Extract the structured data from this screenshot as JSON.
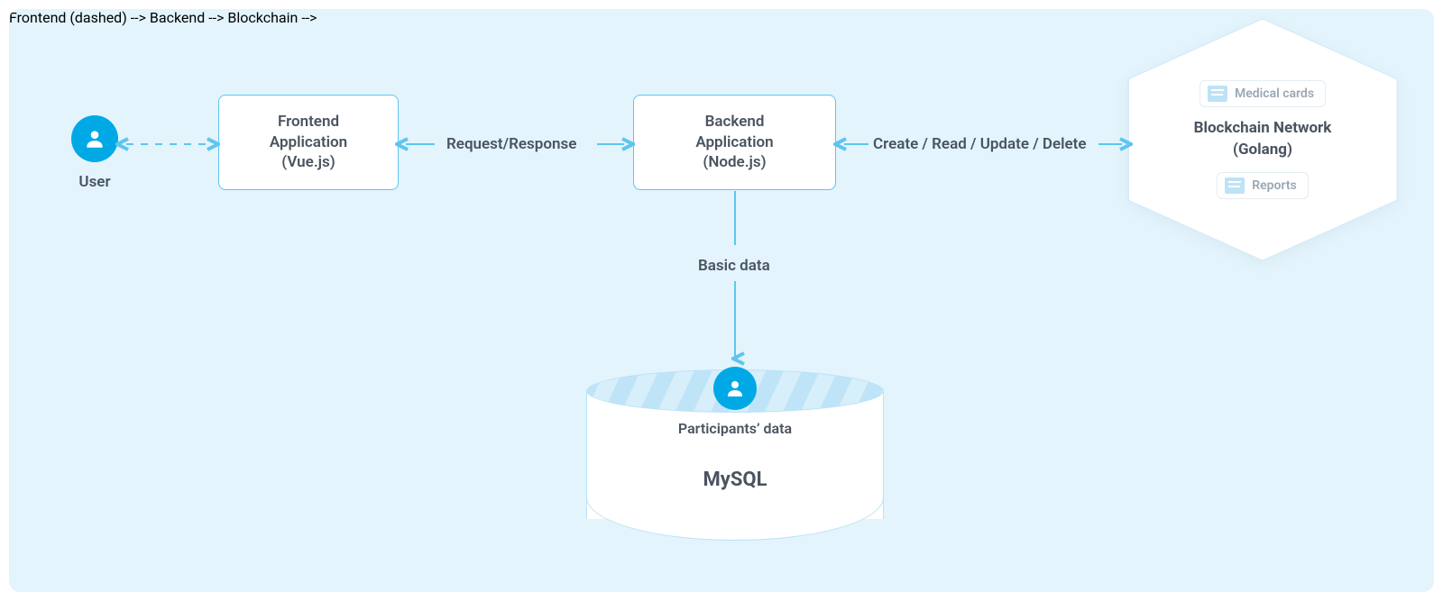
{
  "user": {
    "label": "User"
  },
  "nodes": {
    "frontend": {
      "line1": "Frontend",
      "line2": "Application",
      "line3": "(Vue.js)"
    },
    "backend": {
      "line1": "Backend",
      "line2": "Application",
      "line3": "(Node.js)"
    }
  },
  "edges": {
    "frontend_backend": "Request/Response",
    "backend_blockchain": "Create / Read / Update / Delete",
    "backend_db": "Basic data"
  },
  "database": {
    "title": "MySQL",
    "sublabel": "Participants’ data"
  },
  "blockchain": {
    "title_line1": "Blockchain Network",
    "title_line2": "(Golang)",
    "chips": {
      "medical": "Medical cards",
      "reports": "Reports"
    }
  },
  "colors": {
    "arrow": "#5ec5f0"
  }
}
